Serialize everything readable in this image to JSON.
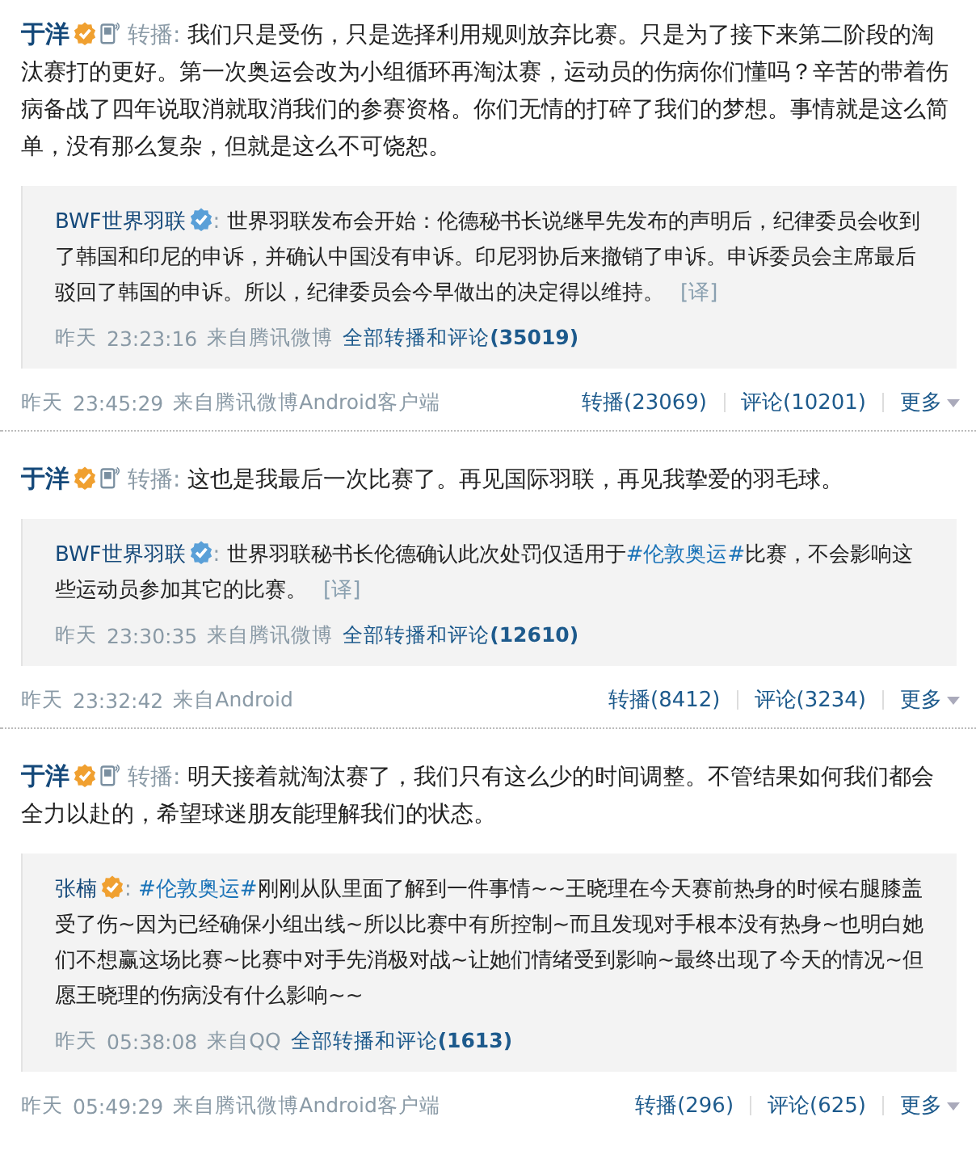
{
  "posts": [
    {
      "author": "于洋",
      "badge": {
        "color": "#f0a030"
      },
      "repost_label": "转播:",
      "text": "我们只是受伤，只是选择利用规则放弃比赛。只是为了接下来第二阶段的淘汰赛打的更好。第一次奥运会改为小组循环再淘汰赛，运动员的伤病你们懂吗？辛苦的带着伤病备战了四年说取消就取消我们的参赛资格。你们无情的打碎了我们的梦想。事情就是这么简单，没有那么复杂，但就是这么不可饶恕。",
      "quote": {
        "author": "BWF世界羽联",
        "badge": {
          "color": "#5aa0d8"
        },
        "separator": ":",
        "segments": [
          {
            "kind": "text",
            "text": "世界羽联发布会开始：伦德秘书长说继早先发布的声明后，纪律委员会收到了韩国和印尼的申诉，并确认中国没有申诉。印尼羽协后来撤销了申诉。申诉委员会主席最后驳回了韩国的申诉。所以，纪律委员会今早做出的决定得以维持。"
          }
        ],
        "translate": "[译]",
        "date": "昨天",
        "time": "23:23:16",
        "source": "来自腾讯微博",
        "all_link": "全部转播和评论",
        "all_count": "(35019)"
      },
      "date": "昨天",
      "time": "23:45:29",
      "source": "来自腾讯微博Android客户端",
      "actions": [
        {
          "kind": "link",
          "label": "转播(23069)"
        },
        {
          "kind": "link",
          "label": "评论(10201)"
        },
        {
          "kind": "menu",
          "label": "更多"
        }
      ]
    },
    {
      "author": "于洋",
      "badge": {
        "color": "#f0a030"
      },
      "repost_label": "转播:",
      "text": "这也是我最后一次比赛了。再见国际羽联，再见我挚爱的羽毛球。",
      "quote": {
        "author": "BWF世界羽联",
        "badge": {
          "color": "#5aa0d8"
        },
        "separator": ":",
        "segments": [
          {
            "kind": "text",
            "text": "世界羽联秘书长伦德确认此次处罚仅适用于"
          },
          {
            "kind": "hashtag",
            "text": "#伦敦奥运#"
          },
          {
            "kind": "text",
            "text": "比赛，不会影响这些运动员参加其它的比赛。"
          }
        ],
        "translate": "[译]",
        "date": "昨天",
        "time": "23:30:35",
        "source": "来自腾讯微博",
        "all_link": "全部转播和评论",
        "all_count": "(12610)"
      },
      "date": "昨天",
      "time": "23:32:42",
      "source": "来自Android",
      "actions": [
        {
          "kind": "link",
          "label": "转播(8412)"
        },
        {
          "kind": "link",
          "label": "评论(3234)"
        },
        {
          "kind": "menu",
          "label": "更多"
        }
      ]
    },
    {
      "author": "于洋",
      "badge": {
        "color": "#f0a030"
      },
      "repost_label": "转播:",
      "text": "明天接着就淘汰赛了，我们只有这么少的时间调整。不管结果如何我们都会全力以赴的，希望球迷朋友能理解我们的状态。",
      "quote": {
        "author": "张楠",
        "badge": {
          "color": "#f0a030"
        },
        "separator": ":",
        "segments": [
          {
            "kind": "hashtag",
            "text": "#伦敦奥运#"
          },
          {
            "kind": "text",
            "text": "刚刚从队里面了解到一件事情~~王晓理在今天赛前热身的时候右腿膝盖受了伤~因为已经确保小组出线~所以比赛中有所控制~而且发现对手根本没有热身~也明白她们不想赢这场比赛~比赛中对手先消极对战~让她们情绪受到影响~最终出现了今天的情况~但愿王晓理的伤病没有什么影响~~"
          }
        ],
        "date": "昨天",
        "time": "05:38:08",
        "source": "来自QQ",
        "all_link": "全部转播和评论",
        "all_count": "(1613)"
      },
      "date": "昨天",
      "time": "05:49:29",
      "source": "来自腾讯微博Android客户端",
      "actions": [
        {
          "kind": "link",
          "label": "转播(296)"
        },
        {
          "kind": "link",
          "label": "评论(625)"
        },
        {
          "kind": "menu",
          "label": "更多"
        }
      ]
    }
  ]
}
